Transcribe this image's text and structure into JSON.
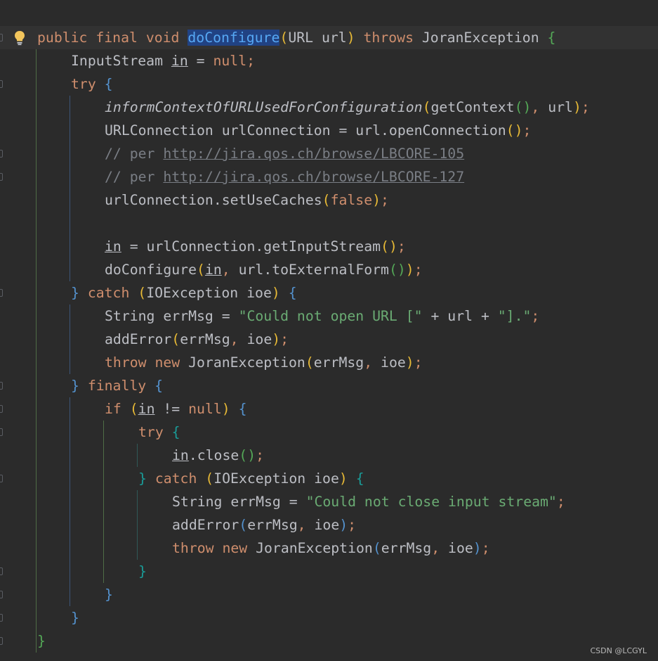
{
  "editor": {
    "lines": [
      {
        "segments": [
          [
            "kw",
            "public final void "
          ],
          [
            "fn-hl",
            "doConfigure"
          ],
          [
            "b1",
            "("
          ],
          [
            "",
            "URL url"
          ],
          [
            "b1",
            ")"
          ],
          [
            "kw",
            " throws "
          ],
          [
            "",
            "JoranException "
          ],
          [
            "b3",
            "{"
          ]
        ]
      },
      {
        "segments": [
          [
            "",
            "InputStream "
          ],
          [
            "u",
            "in"
          ],
          [
            "",
            " = "
          ],
          [
            "kw",
            "null"
          ],
          [
            "kw",
            ";"
          ]
        ]
      },
      {
        "segments": [
          [
            "kw",
            "try "
          ],
          [
            "b2",
            "{"
          ]
        ]
      },
      {
        "segments": [
          [
            "it",
            "informContextOfURLUsedForConfiguration"
          ],
          [
            "b1",
            "("
          ],
          [
            "",
            "getContext"
          ],
          [
            "b3",
            "()"
          ],
          [
            "kw",
            ", "
          ],
          [
            "",
            "url"
          ],
          [
            "b1",
            ")"
          ],
          [
            "kw",
            ";"
          ]
        ]
      },
      {
        "segments": [
          [
            "",
            "URLConnection urlConnection = url.openConnection"
          ],
          [
            "b1",
            "()"
          ],
          [
            "kw",
            ";"
          ]
        ]
      },
      {
        "segments": [
          [
            "cm",
            "// per "
          ],
          [
            "link",
            "http://jira.qos.ch/browse/LBCORE-105"
          ]
        ]
      },
      {
        "segments": [
          [
            "cm",
            "// per "
          ],
          [
            "link",
            "http://jira.qos.ch/browse/LBCORE-127"
          ]
        ]
      },
      {
        "segments": [
          [
            "",
            "urlConnection.setUseCaches"
          ],
          [
            "b1",
            "("
          ],
          [
            "kw",
            "false"
          ],
          [
            "b1",
            ")"
          ],
          [
            "kw",
            ";"
          ]
        ]
      },
      {
        "segments": []
      },
      {
        "segments": [
          [
            "u",
            "in"
          ],
          [
            "",
            " = urlConnection.getInputStream"
          ],
          [
            "b1",
            "()"
          ],
          [
            "kw",
            ";"
          ]
        ]
      },
      {
        "segments": [
          [
            "",
            "doConfigure"
          ],
          [
            "b1",
            "("
          ],
          [
            "u",
            "in"
          ],
          [
            "kw",
            ", "
          ],
          [
            "",
            "url.toExternalForm"
          ],
          [
            "b3",
            "()"
          ],
          [
            "b1",
            ")"
          ],
          [
            "kw",
            ";"
          ]
        ]
      },
      {
        "segments": [
          [
            "b2",
            "}"
          ],
          [
            "kw",
            " catch "
          ],
          [
            "b1",
            "("
          ],
          [
            "",
            "IOException ioe"
          ],
          [
            "b1",
            ")"
          ],
          [
            "",
            " "
          ],
          [
            "b2",
            "{"
          ]
        ]
      },
      {
        "segments": [
          [
            "",
            "String errMsg = "
          ],
          [
            "str",
            "\"Could not open URL [\""
          ],
          [
            "",
            " + url + "
          ],
          [
            "str",
            "\"].\""
          ],
          [
            "kw",
            ";"
          ]
        ]
      },
      {
        "segments": [
          [
            "",
            "addError"
          ],
          [
            "b1",
            "("
          ],
          [
            "",
            "errMsg"
          ],
          [
            "kw",
            ", "
          ],
          [
            "",
            "ioe"
          ],
          [
            "b1",
            ")"
          ],
          [
            "kw",
            ";"
          ]
        ]
      },
      {
        "segments": [
          [
            "kw",
            "throw new "
          ],
          [
            "",
            "JoranException"
          ],
          [
            "b1",
            "("
          ],
          [
            "",
            "errMsg"
          ],
          [
            "kw",
            ", "
          ],
          [
            "",
            "ioe"
          ],
          [
            "b1",
            ")"
          ],
          [
            "kw",
            ";"
          ]
        ]
      },
      {
        "segments": [
          [
            "b2",
            "}"
          ],
          [
            "kw",
            " finally "
          ],
          [
            "b2",
            "{"
          ]
        ]
      },
      {
        "segments": [
          [
            "kw",
            "if "
          ],
          [
            "b1",
            "("
          ],
          [
            "u",
            "in"
          ],
          [
            "",
            " != "
          ],
          [
            "kw",
            "null"
          ],
          [
            "b1",
            ")"
          ],
          [
            "",
            " "
          ],
          [
            "b2",
            "{"
          ]
        ]
      },
      {
        "segments": [
          [
            "kw",
            "try "
          ],
          [
            "b4",
            "{"
          ]
        ]
      },
      {
        "segments": [
          [
            "u",
            "in"
          ],
          [
            "",
            ".close"
          ],
          [
            "b3",
            "()"
          ],
          [
            "kw",
            ";"
          ]
        ]
      },
      {
        "segments": [
          [
            "b4",
            "}"
          ],
          [
            "kw",
            " catch "
          ],
          [
            "b1",
            "("
          ],
          [
            "",
            "IOException ioe"
          ],
          [
            "b1",
            ")"
          ],
          [
            "",
            " "
          ],
          [
            "b4",
            "{"
          ]
        ]
      },
      {
        "segments": [
          [
            "",
            "String errMsg = "
          ],
          [
            "str",
            "\"Could not close input stream\""
          ],
          [
            "kw",
            ";"
          ]
        ]
      },
      {
        "segments": [
          [
            "",
            "addError"
          ],
          [
            "b2",
            "("
          ],
          [
            "",
            "errMsg"
          ],
          [
            "kw",
            ", "
          ],
          [
            "",
            "ioe"
          ],
          [
            "b2",
            ")"
          ],
          [
            "kw",
            ";"
          ]
        ]
      },
      {
        "segments": [
          [
            "kw",
            "throw new "
          ],
          [
            "",
            "JoranException"
          ],
          [
            "b2",
            "("
          ],
          [
            "",
            "errMsg"
          ],
          [
            "kw",
            ", "
          ],
          [
            "",
            "ioe"
          ],
          [
            "b2",
            ")"
          ],
          [
            "kw",
            ";"
          ]
        ]
      },
      {
        "segments": [
          [
            "b4",
            "}"
          ]
        ]
      },
      {
        "segments": [
          [
            "b2",
            "}"
          ]
        ]
      },
      {
        "segments": [
          [
            "b2",
            "}"
          ]
        ]
      },
      {
        "segments": [
          [
            "b3",
            "}"
          ]
        ]
      }
    ]
  },
  "watermark": "CSDN @LCGYL",
  "colors": {
    "background": "#2b2b2b",
    "current_line": "#323232",
    "keyword": "#cf8e6d",
    "function_decl": "#56a8f5",
    "string": "#6aab73",
    "comment": "#7a7e85",
    "bracket_gold": "#e8ba36",
    "bracket_blue": "#5492ce",
    "bracket_green": "#54a857",
    "bracket_teal": "#1a9c98",
    "selection_highlight": "#214283"
  },
  "icons": {
    "intention_bulb": "lightbulb-icon",
    "fold_marker": "fold-marker-icon"
  }
}
